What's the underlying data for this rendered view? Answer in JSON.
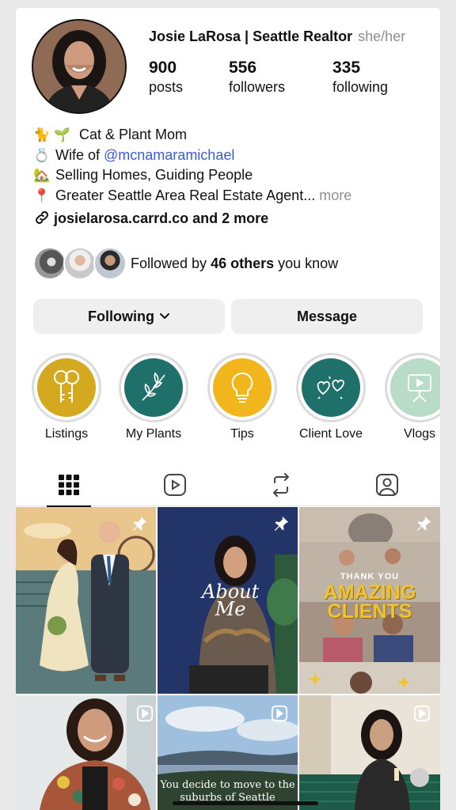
{
  "profile": {
    "name": "Josie LaRosa | Seattle Realtor",
    "pronouns": "she/her",
    "stats": [
      {
        "value": "900",
        "label": "posts"
      },
      {
        "value": "556",
        "label": "followers"
      },
      {
        "value": "335",
        "label": "following"
      }
    ]
  },
  "bio": {
    "line1_emoji": "🐈 🌱",
    "line1_text": "Cat & Plant Mom",
    "line2_emoji": "💍",
    "line2_text": "Wife of ",
    "line2_mention": "@mcnamaramichael",
    "line3_emoji": "🏡",
    "line3_text": "Selling Homes, Guiding People",
    "line4_emoji": "📍",
    "line4_text": "Greater Seattle Area Real Estate Agent...",
    "line4_more": "more",
    "link_text": "josielarosa.carrd.co and 2 more"
  },
  "followed_by": {
    "prefix": "Followed by ",
    "count": "46 others",
    "suffix": " you know"
  },
  "buttons": {
    "following": "Following",
    "message": "Message"
  },
  "highlights": [
    {
      "label": "Listings",
      "color": "#d4a91f",
      "icon": "keys-icon"
    },
    {
      "label": "My Plants",
      "color": "#1f6f6a",
      "icon": "plant-icon"
    },
    {
      "label": "Tips",
      "color": "#f0b61b",
      "icon": "lightbulb-icon"
    },
    {
      "label": "Client Love",
      "color": "#1f6f6a",
      "icon": "hearts-icon"
    },
    {
      "label": "Vlogs",
      "color": "#b9dcc8",
      "icon": "camera-icon"
    }
  ],
  "tabs": [
    "grid-icon",
    "reels-icon",
    "reposts-icon",
    "tagged-icon"
  ],
  "posts": {
    "p2_text_a": "About",
    "p2_text_b": "Me",
    "p3_small": "THANK YOU",
    "p3_big_a": "AMAZING",
    "p3_big_b": "CLIENTS",
    "p5_text_a": "You decide to move to the",
    "p5_text_b": "suburbs of Seattle"
  }
}
